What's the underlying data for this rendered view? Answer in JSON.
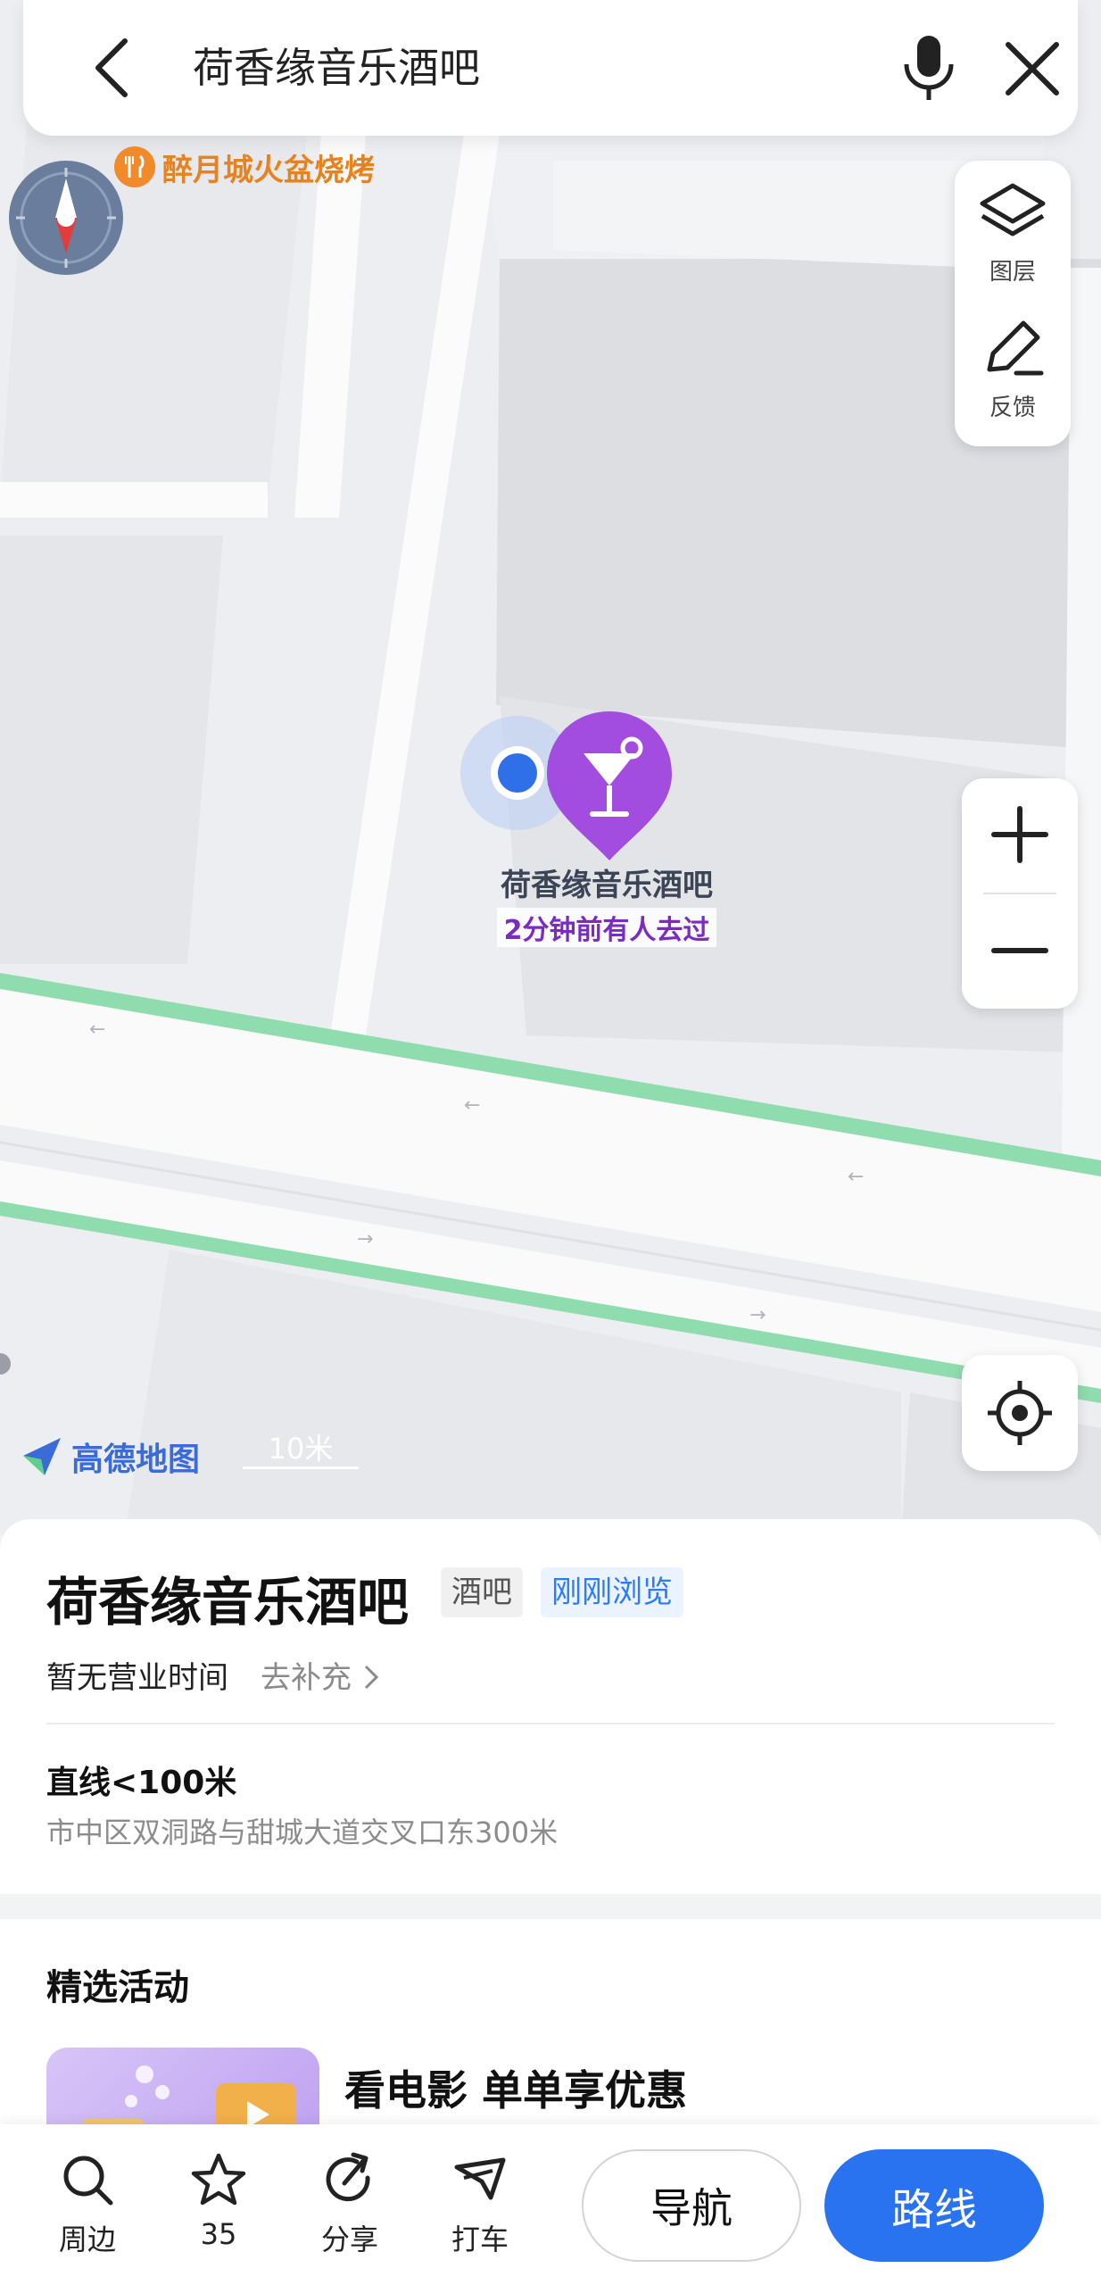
{
  "search": {
    "query": "荷香缘音乐酒吧"
  },
  "map": {
    "nearby_poi": "醉月城火盆烧烤",
    "side_tools": [
      {
        "label": "图层",
        "icon": "layers-icon"
      },
      {
        "label": "反馈",
        "icon": "edit-pen-icon"
      }
    ],
    "marker": {
      "name": "荷香缘音乐酒吧",
      "subtitle": "2分钟前有人去过",
      "icon": "cocktail-icon",
      "color": "#a34de0"
    },
    "brand": "高德地图",
    "scale": "10米"
  },
  "poi": {
    "name": "荷香缘音乐酒吧",
    "category_tag": "酒吧",
    "recent_tag": "刚刚浏览",
    "hours": "暂无营业时间",
    "add_hours_link": "去补充",
    "distance": "直线<100米",
    "address": "市中区双洞路与甜城大道交叉口东300米"
  },
  "activities": {
    "heading": "精选活动",
    "item_title": "看电影 单单享优惠"
  },
  "bottom_bar": {
    "items": [
      {
        "label": "周边",
        "icon": "search-icon"
      },
      {
        "label": "35",
        "icon": "star-icon"
      },
      {
        "label": "分享",
        "icon": "share-icon"
      },
      {
        "label": "打车",
        "icon": "taxi-icon"
      }
    ],
    "navigate_label": "导航",
    "route_label": "路线"
  },
  "colors": {
    "accent": "#2a73f0",
    "road_green": "#8fdcae",
    "marker_purple": "#a34de0"
  }
}
